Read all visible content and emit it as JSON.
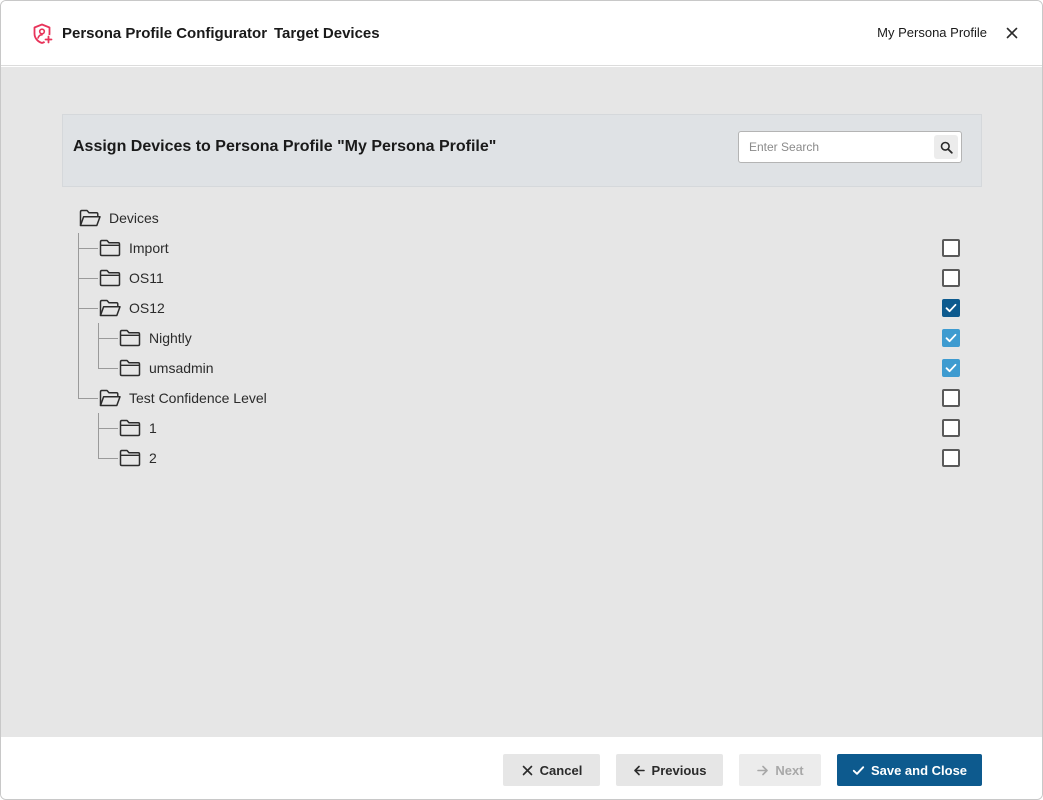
{
  "header": {
    "app_title": "Persona Profile Configurator",
    "step_title": "Target Devices",
    "profile_name": "My Persona Profile",
    "logo_icon": "persona-shield-icon",
    "close_icon": "close-icon",
    "logo_color": "#e8345a"
  },
  "panel": {
    "title": "Assign Devices to Persona Profile \"My Persona Profile\"",
    "search": {
      "placeholder": "Enter Search",
      "value": "",
      "icon": "search-icon"
    }
  },
  "tree": {
    "root": {
      "label": "Devices",
      "expanded": true
    },
    "items": [
      {
        "label": "Import",
        "level": 1,
        "expanded": false,
        "checkbox": "unchecked"
      },
      {
        "label": "OS11",
        "level": 1,
        "expanded": false,
        "checkbox": "unchecked"
      },
      {
        "label": "OS12",
        "level": 1,
        "expanded": true,
        "checkbox": "checked"
      },
      {
        "label": "Nightly",
        "level": 2,
        "expanded": false,
        "checkbox": "inherited"
      },
      {
        "label": "umsadmin",
        "level": 2,
        "expanded": false,
        "checkbox": "inherited"
      },
      {
        "label": "Test Confidence Level",
        "level": 1,
        "expanded": true,
        "checkbox": "unchecked"
      },
      {
        "label": "1",
        "level": 2,
        "expanded": false,
        "checkbox": "unchecked"
      },
      {
        "label": "2",
        "level": 2,
        "expanded": false,
        "checkbox": "unchecked"
      }
    ]
  },
  "footer": {
    "cancel_label": "Cancel",
    "previous_label": "Previous",
    "next_label": "Next",
    "save_label": "Save and Close",
    "next_disabled": true
  },
  "colors": {
    "primary": "#0d5a8e",
    "inherited_check": "#3e9bd0",
    "content_bg": "#e6e6e6",
    "panel_bg": "#dfe2e5"
  }
}
